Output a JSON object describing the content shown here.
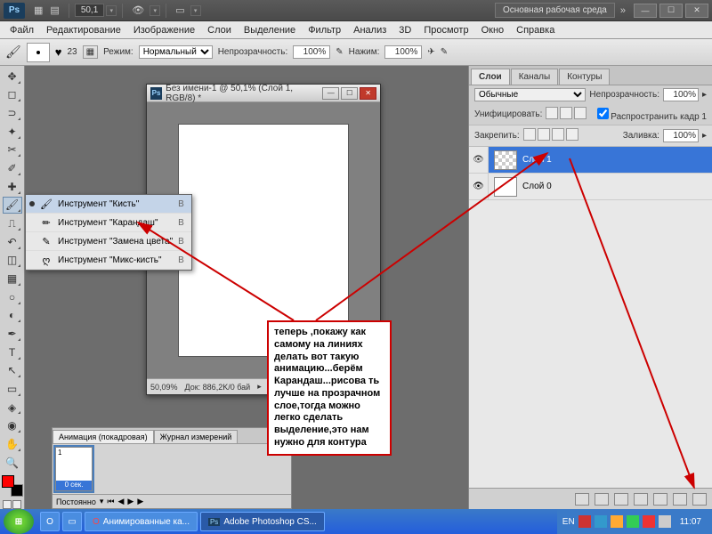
{
  "titlebar": {
    "app_abbrev": "Ps",
    "zoom": "50,1",
    "workspace_label": "Основная рабочая среда"
  },
  "menubar": [
    "Файл",
    "Редактирование",
    "Изображение",
    "Слои",
    "Выделение",
    "Фильтр",
    "Анализ",
    "3D",
    "Просмотр",
    "Окно",
    "Справка"
  ],
  "options": {
    "brush_size": "23",
    "mode_label": "Режим:",
    "mode_value": "Нормальный",
    "opacity_label": "Непрозрачность:",
    "opacity_value": "100%",
    "flow_label": "Нажим:",
    "flow_value": "100%"
  },
  "document": {
    "title": "Без имени-1 @ 50,1% (Слой 1, RGB/8) *",
    "status_zoom": "50,09%",
    "status_doc": "Док: 886,2K/0 бай"
  },
  "flyout": {
    "items": [
      {
        "label": "Инструмент \"Кисть\"",
        "shortcut": "B",
        "sel": true
      },
      {
        "label": "Инструмент \"Карандаш\"",
        "shortcut": "B",
        "sel": false
      },
      {
        "label": "Инструмент \"Замена цвета\"",
        "shortcut": "B",
        "sel": false
      },
      {
        "label": "Инструмент \"Микс-кисть\"",
        "shortcut": "B",
        "sel": false
      }
    ]
  },
  "layers_panel": {
    "tabs": [
      "Слои",
      "Каналы",
      "Контуры"
    ],
    "blend_mode": "Обычные",
    "opacity_label": "Непрозрачность:",
    "opacity_value": "100%",
    "unify_label": "Унифицировать:",
    "propagate_label": "Распространить кадр 1",
    "lock_label": "Закрепить:",
    "fill_label": "Заливка:",
    "fill_value": "100%",
    "layers": [
      {
        "name": "Слой 1",
        "selected": true,
        "checker": true
      },
      {
        "name": "Слой 0",
        "selected": false,
        "checker": false
      }
    ]
  },
  "animation": {
    "tabs": [
      "Анимация (покадровая)",
      "Журнал измерений"
    ],
    "frame_num": "1",
    "frame_dur": "0 сек.",
    "loop_label": "Постоянно"
  },
  "annotation": "теперь ,покажу как самому на линиях делать вот такую анимацию...берём Карандаш...рисова ть лучше на прозрачном слое,тогда можно легко сделать выделение,это нам нужно для контура",
  "taskbar": {
    "items": [
      "Анимированные ка...",
      "Adobe Photoshop CS..."
    ],
    "lang": "EN",
    "time": "11:07"
  }
}
